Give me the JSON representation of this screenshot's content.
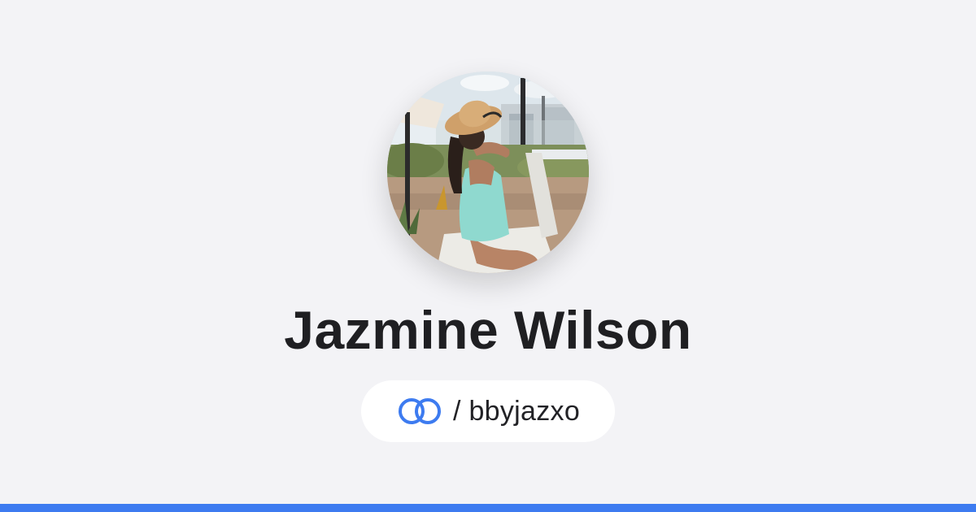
{
  "profile": {
    "name": "Jazmine Wilson",
    "handle": "/ bbyjazxo",
    "avatar": "profile-photo"
  },
  "icons": {
    "link": "linked-rings-icon"
  },
  "colors": {
    "background": "#f3f3f6",
    "accent": "#3d7bf0",
    "name_text": "#1f1f22",
    "pill_background": "#ffffff"
  }
}
